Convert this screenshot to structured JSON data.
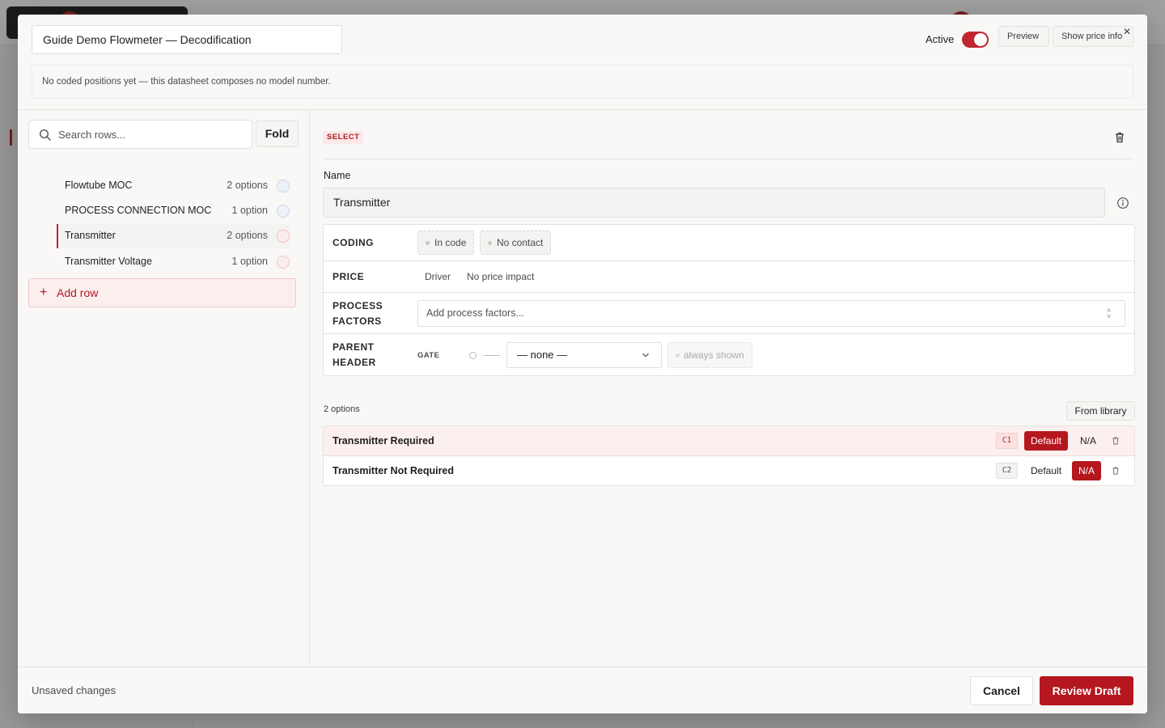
{
  "header": {
    "title": "Guide Demo Flowmeter — Decodification",
    "active_label": "Active",
    "active": true,
    "preview_label": "Preview",
    "price_info_label": "Show price info",
    "notice": "No coded positions yet — this datasheet composes no model number."
  },
  "sidebar": {
    "search_placeholder": "Search rows...",
    "fold_label": "Fold",
    "rows": [
      {
        "label": "Flowtube MOC",
        "count": "2 options",
        "link_color": "blue"
      },
      {
        "label": "PROCESS CONNECTION MOC",
        "count": "1 option",
        "link_color": "blue"
      },
      {
        "label": "Transmitter",
        "count": "2 options",
        "link_color": "red",
        "selected": true
      },
      {
        "label": "Transmitter Voltage",
        "count": "1 option",
        "link_color": "red"
      }
    ],
    "add_row_label": "Add row"
  },
  "detail": {
    "type_badge": "SELECT",
    "name_label": "Name",
    "name_value": "Transmitter",
    "coding": {
      "key": "CODING",
      "in_code": "In code",
      "no_contact": "No contact"
    },
    "price": {
      "key": "PRICE",
      "driver": "Driver",
      "impact": "No price impact"
    },
    "process_factors": {
      "key": "PROCESS FACTORS",
      "placeholder": "Add process factors..."
    },
    "parent_header": {
      "key": "PARENT HEADER",
      "gate": "GATE",
      "selected": "— none —",
      "always_shown": "always shown"
    },
    "options_count": "2 options",
    "from_library_label": "From library",
    "options": [
      {
        "name": "Transmitter Required",
        "code": "C1",
        "default_label": "Default",
        "na_label": "N/A",
        "state": "default"
      },
      {
        "name": "Transmitter Not Required",
        "code": "C2",
        "default_label": "Default",
        "na_label": "N/A",
        "state": "na"
      }
    ]
  },
  "footer": {
    "status": "Unsaved changes",
    "cancel_label": "Cancel",
    "review_label": "Review Draft"
  },
  "colors": {
    "accent": "#b5171e",
    "accent_light": "#fdeeee"
  }
}
